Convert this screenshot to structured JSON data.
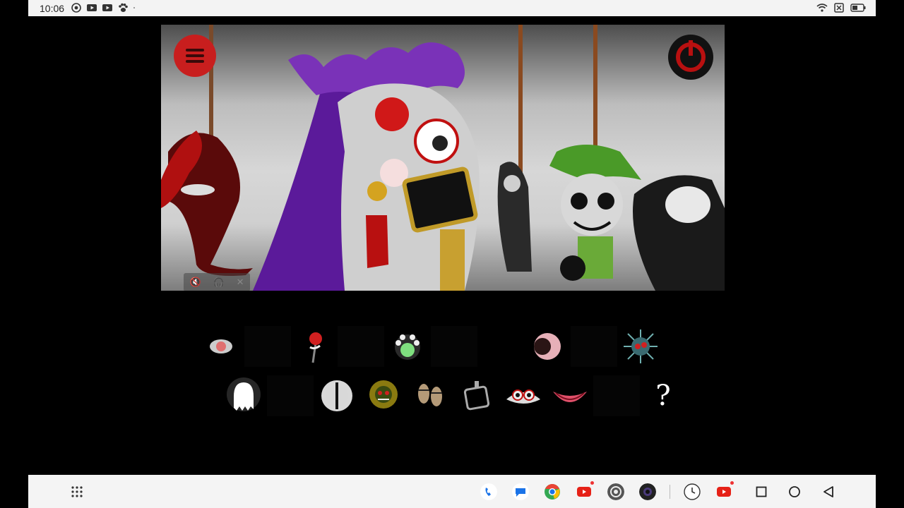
{
  "status_bar": {
    "time": "10:06",
    "left_icons": [
      "target-icon",
      "youtube-icon",
      "youtube-icon",
      "paw-icon",
      "dot-icon"
    ],
    "right_icons": [
      "wifi-icon",
      "sim-icon",
      "battery-icon"
    ]
  },
  "game": {
    "menu_icon": "hamburger-menu-icon",
    "power_icon": "power-icon",
    "mini_controls": [
      "mute-icon",
      "headphones-icon",
      "close-icon"
    ],
    "row1": [
      {
        "name": "sound-eye-disc",
        "filled": true
      },
      {
        "name": "empty",
        "filled": false
      },
      {
        "name": "sound-red-flower",
        "filled": true
      },
      {
        "name": "empty",
        "filled": false
      },
      {
        "name": "sound-multi-eye-green",
        "filled": true
      },
      {
        "name": "empty",
        "filled": false
      },
      {
        "name": "empty",
        "filled": false
      },
      {
        "name": "sound-pink-moon",
        "filled": true
      },
      {
        "name": "empty",
        "filled": false
      },
      {
        "name": "sound-spiky-virus",
        "filled": true
      }
    ],
    "row2": [
      {
        "name": "sound-white-ghost",
        "filled": true
      },
      {
        "name": "empty",
        "filled": false
      },
      {
        "name": "sound-slit-eye",
        "filled": true
      },
      {
        "name": "sound-sunflower-face",
        "filled": true
      },
      {
        "name": "sound-footprints",
        "filled": true
      },
      {
        "name": "sound-phone-frame",
        "filled": true
      },
      {
        "name": "sound-bloody-eyes",
        "filled": true
      },
      {
        "name": "sound-pink-mouth",
        "filled": true
      },
      {
        "name": "empty",
        "filled": false
      },
      {
        "name": "mystery",
        "filled": true
      }
    ],
    "mystery_label": "?"
  },
  "nav_bar": {
    "apps": [
      "phone-icon",
      "messages-icon",
      "chrome-icon",
      "youtube-icon",
      "settings-icon",
      "camera-icon",
      "clock-icon",
      "youtube-icon"
    ],
    "buttons": [
      "recents-button",
      "home-button",
      "back-button"
    ]
  }
}
